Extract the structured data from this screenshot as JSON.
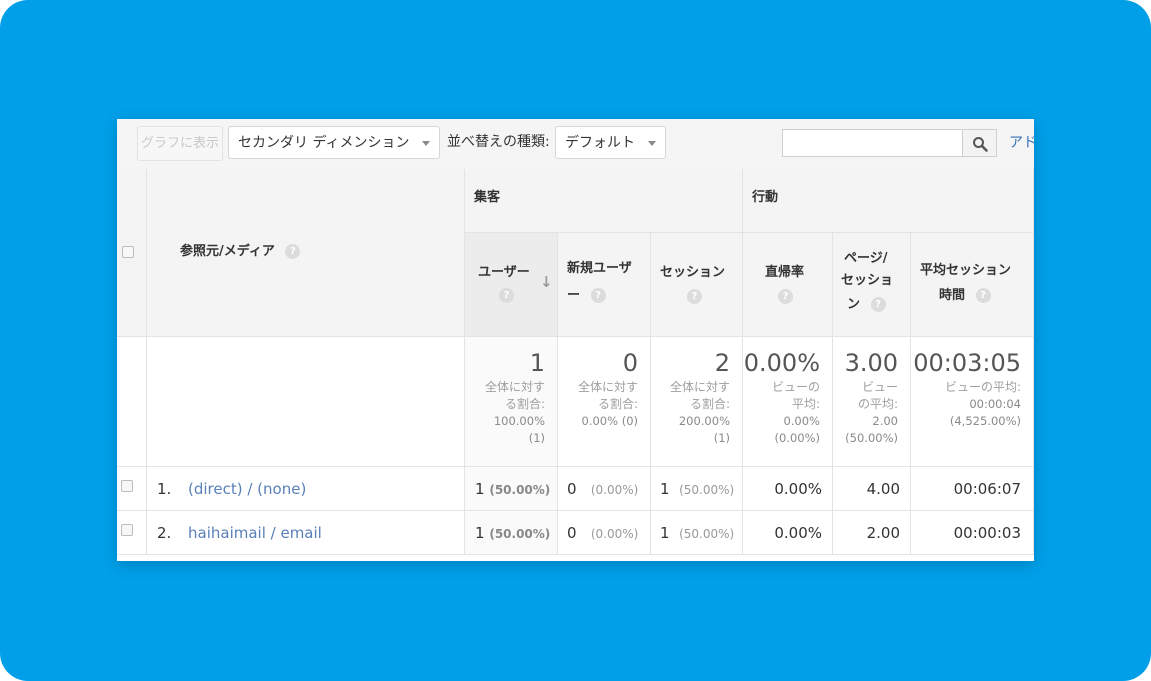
{
  "toolbar": {
    "graph_button": "グラフに表示",
    "secondary_dimension": "セカンダリ ディメンション",
    "sort_label": "並べ替えの種類:",
    "sort_value": "デフォルト",
    "search_placeholder": "",
    "advanced_link": "アドバンス"
  },
  "header": {
    "dimension": "参照元/メディア",
    "group_acquisition": "集客",
    "group_behavior": "行動",
    "col_users": "ユーザー",
    "col_new_users_1": "新規ユーザ",
    "col_new_users_2": "ー",
    "col_sessions": "セッション",
    "col_bounce": "直帰率",
    "col_pages_1": "ページ/",
    "col_pages_2": "セッショ",
    "col_pages_3": "ン",
    "col_duration_1": "平均セッション",
    "col_duration_2": "時間",
    "help": "?",
    "sort_arrow": "↓"
  },
  "totals": {
    "users": {
      "value": "1",
      "l1": "全体に対す",
      "l2": "る割合:",
      "l3": "100.00%",
      "l4": "(1)"
    },
    "new_users": {
      "value": "0",
      "l1": "全体に対す",
      "l2": "る割合:",
      "l3": "0.00% (0)"
    },
    "sessions": {
      "value": "2",
      "l1": "全体に対す",
      "l2": "る割合:",
      "l3": "200.00%",
      "l4": "(1)"
    },
    "bounce": {
      "value": "0.00%",
      "l1": "ビューの",
      "l2": "平均:",
      "l3": "0.00%",
      "l4": "(0.00%)"
    },
    "pages": {
      "value": "3.00",
      "l1": "ビュー",
      "l2": "の平均:",
      "l3": "2.00",
      "l4": "(50.00%)"
    },
    "duration": {
      "value": "00:03:05",
      "l1": "ビューの平均:",
      "l2": "00:00:04",
      "l3": "(4,525.00%)"
    }
  },
  "rows": [
    {
      "index": "1.",
      "source": "(direct) / (none)",
      "users": "1",
      "users_pct": "(50.00%)",
      "new_users": "0",
      "new_users_pct": "(0.00%)",
      "sessions": "1",
      "sessions_pct": "(50.00%)",
      "bounce": "0.00%",
      "pages": "4.00",
      "duration": "00:06:07"
    },
    {
      "index": "2.",
      "source": "haihaimail / email",
      "users": "1",
      "users_pct": "(50.00%)",
      "new_users": "0",
      "new_users_pct": "(0.00%)",
      "sessions": "1",
      "sessions_pct": "(50.00%)",
      "bounce": "0.00%",
      "pages": "2.00",
      "duration": "00:00:03"
    }
  ],
  "colors": {
    "background": "#009fe8",
    "link": "#5a80b8",
    "header_bg": "#f4f4f4"
  }
}
